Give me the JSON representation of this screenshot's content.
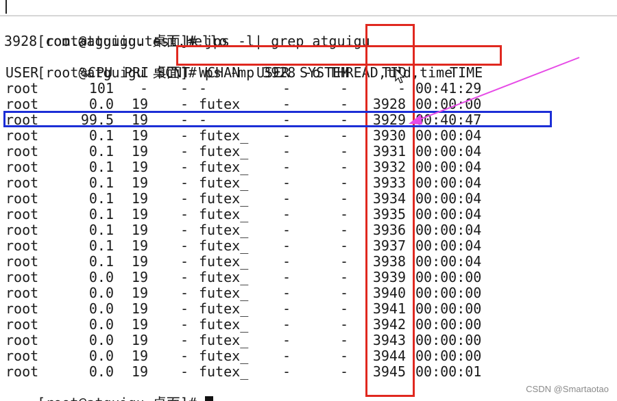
{
  "terminal": {
    "lines": {
      "cmd1_prompt": "[root@atguigu 桌面]# ",
      "cmd1_text": "jps -l| grep atguigu",
      "jps_output": "3928 com.atguigu.test.Hello",
      "cmd2_prompt": "[root@atguigu 桌面]# ",
      "cmd2_text": "ps -mp 3928 -o THREAD,tid,time",
      "final_prompt": "[root@atguigu 桌面]# "
    },
    "columns": [
      "USER",
      "%CPU",
      "PRI",
      "SCNT",
      "WCHAN",
      "USER",
      "SYSTEM",
      "TID",
      "TIME"
    ],
    "rows": [
      {
        "user": "root",
        "cpu": "101",
        "pri": "-",
        "scnt": "-",
        "wchan": "-",
        "usr": "-",
        "sys": "-",
        "tid": "-",
        "time": "00:41:29"
      },
      {
        "user": "root",
        "cpu": "0.0",
        "pri": "19",
        "scnt": "-",
        "wchan": "futex",
        "usr": "-",
        "sys": "-",
        "tid": "3928",
        "time": "00:00:00"
      },
      {
        "user": "root",
        "cpu": "99.5",
        "pri": "19",
        "scnt": "-",
        "wchan": "-",
        "usr": "-",
        "sys": "-",
        "tid": "3929",
        "time": "00:40:47"
      },
      {
        "user": "root",
        "cpu": "0.1",
        "pri": "19",
        "scnt": "-",
        "wchan": "futex_",
        "usr": "-",
        "sys": "-",
        "tid": "3930",
        "time": "00:00:04"
      },
      {
        "user": "root",
        "cpu": "0.1",
        "pri": "19",
        "scnt": "-",
        "wchan": "futex_",
        "usr": "-",
        "sys": "-",
        "tid": "3931",
        "time": "00:00:04"
      },
      {
        "user": "root",
        "cpu": "0.1",
        "pri": "19",
        "scnt": "-",
        "wchan": "futex_",
        "usr": "-",
        "sys": "-",
        "tid": "3932",
        "time": "00:00:04"
      },
      {
        "user": "root",
        "cpu": "0.1",
        "pri": "19",
        "scnt": "-",
        "wchan": "futex_",
        "usr": "-",
        "sys": "-",
        "tid": "3933",
        "time": "00:00:04"
      },
      {
        "user": "root",
        "cpu": "0.1",
        "pri": "19",
        "scnt": "-",
        "wchan": "futex_",
        "usr": "-",
        "sys": "-",
        "tid": "3934",
        "time": "00:00:04"
      },
      {
        "user": "root",
        "cpu": "0.1",
        "pri": "19",
        "scnt": "-",
        "wchan": "futex_",
        "usr": "-",
        "sys": "-",
        "tid": "3935",
        "time": "00:00:04"
      },
      {
        "user": "root",
        "cpu": "0.1",
        "pri": "19",
        "scnt": "-",
        "wchan": "futex_",
        "usr": "-",
        "sys": "-",
        "tid": "3936",
        "time": "00:00:04"
      },
      {
        "user": "root",
        "cpu": "0.1",
        "pri": "19",
        "scnt": "-",
        "wchan": "futex_",
        "usr": "-",
        "sys": "-",
        "tid": "3937",
        "time": "00:00:04"
      },
      {
        "user": "root",
        "cpu": "0.1",
        "pri": "19",
        "scnt": "-",
        "wchan": "futex_",
        "usr": "-",
        "sys": "-",
        "tid": "3938",
        "time": "00:00:04"
      },
      {
        "user": "root",
        "cpu": "0.0",
        "pri": "19",
        "scnt": "-",
        "wchan": "futex_",
        "usr": "-",
        "sys": "-",
        "tid": "3939",
        "time": "00:00:00"
      },
      {
        "user": "root",
        "cpu": "0.0",
        "pri": "19",
        "scnt": "-",
        "wchan": "futex_",
        "usr": "-",
        "sys": "-",
        "tid": "3940",
        "time": "00:00:00"
      },
      {
        "user": "root",
        "cpu": "0.0",
        "pri": "19",
        "scnt": "-",
        "wchan": "futex_",
        "usr": "-",
        "sys": "-",
        "tid": "3941",
        "time": "00:00:00"
      },
      {
        "user": "root",
        "cpu": "0.0",
        "pri": "19",
        "scnt": "-",
        "wchan": "futex_",
        "usr": "-",
        "sys": "-",
        "tid": "3942",
        "time": "00:00:00"
      },
      {
        "user": "root",
        "cpu": "0.0",
        "pri": "19",
        "scnt": "-",
        "wchan": "futex_",
        "usr": "-",
        "sys": "-",
        "tid": "3943",
        "time": "00:00:00"
      },
      {
        "user": "root",
        "cpu": "0.0",
        "pri": "19",
        "scnt": "-",
        "wchan": "futex_",
        "usr": "-",
        "sys": "-",
        "tid": "3944",
        "time": "00:00:00"
      },
      {
        "user": "root",
        "cpu": "0.0",
        "pri": "19",
        "scnt": "-",
        "wchan": "futex_",
        "usr": "-",
        "sys": "-",
        "tid": "3945",
        "time": "00:00:01"
      }
    ]
  },
  "watermark": "CSDN @Smartaotao",
  "colors": {
    "highlight_red": "#e0281f",
    "highlight_blue": "#1c2ed6",
    "arrow_magenta": "#e64ae6",
    "text": "#1a1a1a"
  },
  "icons": {
    "cursor": "mouse-pointer-icon",
    "arrow": "annotation-arrow-icon"
  }
}
